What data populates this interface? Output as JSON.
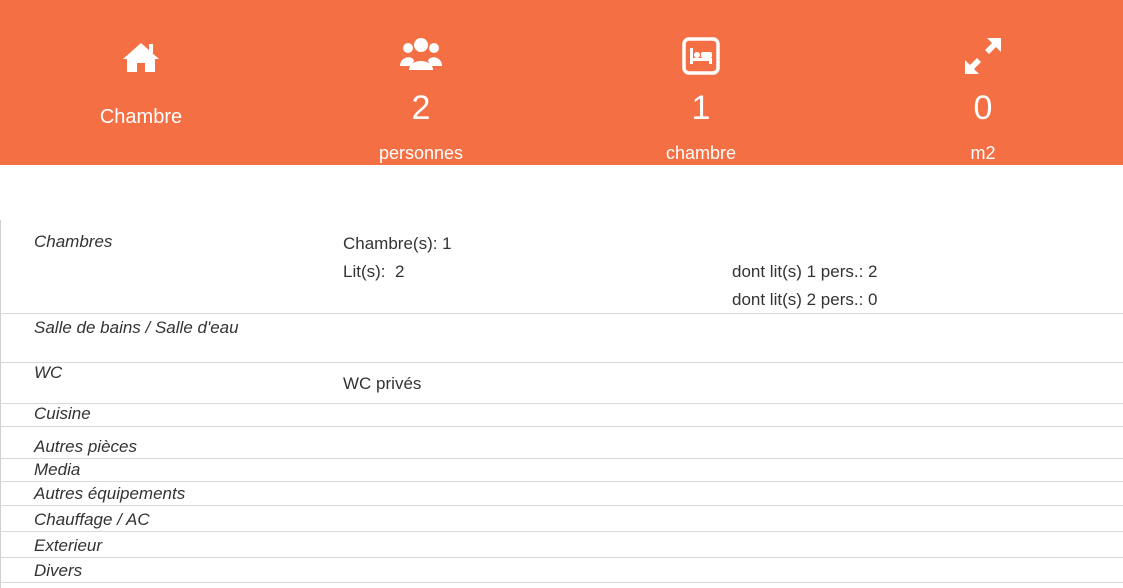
{
  "summary": {
    "type_label": "Chambre",
    "persons": {
      "value": "2",
      "unit": "personnes"
    },
    "rooms": {
      "value": "1",
      "unit": "chambre"
    },
    "area": {
      "value": "0",
      "unit": "m2"
    }
  },
  "icons": {
    "type": "home-icon",
    "persons": "users-icon",
    "rooms": "bed-icon",
    "area": "expand-icon"
  },
  "colors": {
    "banner": "#f46f43",
    "text": "#333333",
    "divider": "#d9d9d9"
  },
  "details": {
    "chambres": {
      "label": "Chambres",
      "rooms_line": "Chambre(s): 1",
      "beds_line": "Lit(s):  2",
      "single_beds": "dont lit(s) 1 pers.: 2",
      "double_beds": "dont lit(s) 2 pers.: 0"
    },
    "bathroom": {
      "label": "Salle de bains / Salle d'eau"
    },
    "wc": {
      "label": "WC",
      "value": "WC privés"
    },
    "kitchen": {
      "label": "Cuisine"
    },
    "other_rooms": {
      "label": "Autres pièces"
    },
    "media": {
      "label": "Media"
    },
    "equipment": {
      "label": "Autres équipements"
    },
    "heating": {
      "label": "Chauffage / AC"
    },
    "exterior": {
      "label": "Exterieur"
    },
    "misc": {
      "label": "Divers"
    }
  }
}
